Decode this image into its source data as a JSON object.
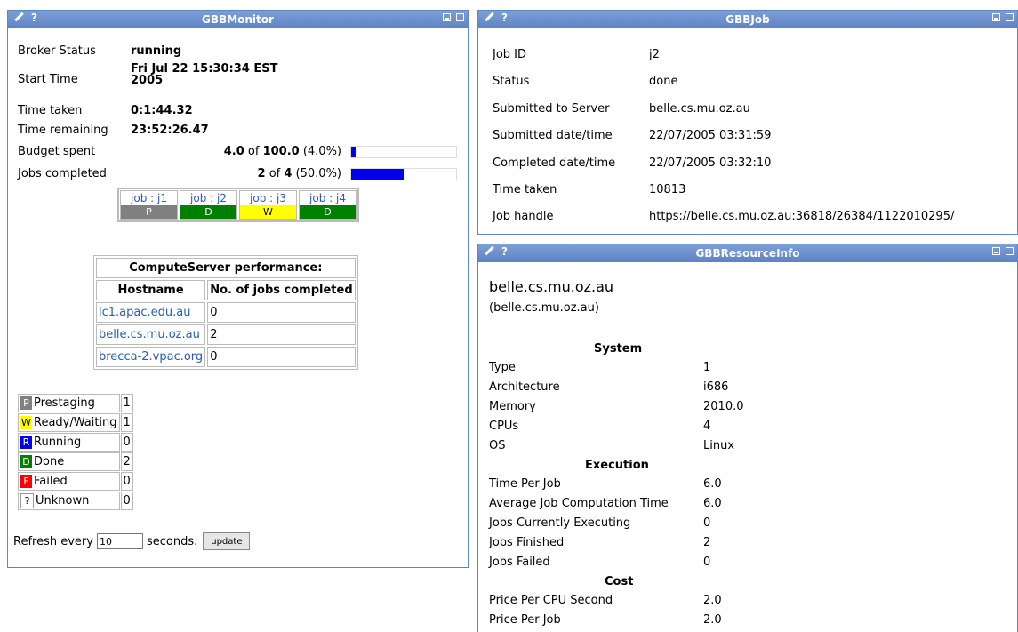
{
  "monitor": {
    "title": "GBBMonitor",
    "broker_status_label": "Broker Status",
    "broker_status": "running",
    "start_time_label": "Start Time",
    "start_time_line1": "Fri Jul 22 15:30:34 EST",
    "start_time_line2": "2005",
    "time_taken_label": "Time taken",
    "time_taken": "0:1:44.32",
    "time_remaining_label": "Time remaining",
    "time_remaining": "23:52:26.47",
    "budget_label": "Budget spent",
    "budget_spent": "4.0",
    "budget_of": "of",
    "budget_total": "100.0",
    "budget_pct": "(4.0%)",
    "budget_fraction": 0.04,
    "jobs_label": "Jobs completed",
    "jobs_done": "2",
    "jobs_of": "of",
    "jobs_total": "4",
    "jobs_pct": "(50.0%)",
    "jobs_fraction": 0.5,
    "jobs": [
      {
        "label": "job : j1",
        "status": "P",
        "color": "#808080",
        "text_color": "#ffffff"
      },
      {
        "label": "job : j2",
        "status": "D",
        "color": "#008000",
        "text_color": "#ffffff"
      },
      {
        "label": "job : j3",
        "status": "W",
        "color": "#ffff00",
        "text_color": "#000000"
      },
      {
        "label": "job : j4",
        "status": "D",
        "color": "#008000",
        "text_color": "#ffffff"
      }
    ],
    "perf": {
      "title": "ComputeServer performance:",
      "col_hostname": "Hostname",
      "col_jobs": "No. of jobs completed",
      "rows": [
        {
          "host": "lc1.apac.edu.au",
          "count": "0"
        },
        {
          "host": "belle.cs.mu.oz.au",
          "count": "2"
        },
        {
          "host": "brecca-2.vpac.org",
          "count": "0"
        }
      ]
    },
    "legend": [
      {
        "code": "P",
        "name": "Prestaging",
        "count": "1",
        "color": "#808080",
        "text_color": "#ffffff"
      },
      {
        "code": "W",
        "name": "Ready/Waiting",
        "count": "1",
        "color": "#ffff00",
        "text_color": "#000000"
      },
      {
        "code": "R",
        "name": "Running",
        "count": "0",
        "color": "#0000ee",
        "text_color": "#ffffff"
      },
      {
        "code": "D",
        "name": "Done",
        "count": "2",
        "color": "#008000",
        "text_color": "#ffffff"
      },
      {
        "code": "F",
        "name": "Failed",
        "count": "0",
        "color": "#ff0000",
        "text_color": "#ffffff"
      },
      {
        "code": "?",
        "name": "Unknown",
        "count": "0",
        "color": "#ffffff",
        "text_color": "#000000"
      }
    ],
    "refresh_label": "Refresh every",
    "refresh_value": "10",
    "refresh_unit": "seconds.",
    "update_label": "update"
  },
  "job": {
    "title": "GBBJob",
    "rows": [
      {
        "label": "Job ID",
        "value": "j2"
      },
      {
        "label": "Status",
        "value": "done"
      },
      {
        "label": "Submitted to Server",
        "value": "belle.cs.mu.oz.au"
      },
      {
        "label": "Submitted date/time",
        "value": "22/07/2005 03:31:59"
      },
      {
        "label": "Completed date/time",
        "value": "22/07/2005 03:32:10"
      },
      {
        "label": "Time taken",
        "value": "10813"
      },
      {
        "label": "Job handle",
        "value": "https://belle.cs.mu.oz.au:36818/26384/1122010295/"
      }
    ]
  },
  "resource": {
    "title": "GBBResourceInfo",
    "host": "belle.cs.mu.oz.au",
    "host_sub": "(belle.cs.mu.oz.au)",
    "system_heading": "System",
    "system": [
      {
        "label": "Type",
        "value": "1"
      },
      {
        "label": "Architecture",
        "value": "i686"
      },
      {
        "label": "Memory",
        "value": "2010.0"
      },
      {
        "label": "CPUs",
        "value": "4"
      },
      {
        "label": "OS",
        "value": "Linux"
      }
    ],
    "execution_heading": "Execution",
    "execution": [
      {
        "label": "Time Per Job",
        "value": "6.0"
      },
      {
        "label": "Average Job Computation Time",
        "value": "6.0"
      },
      {
        "label": "Jobs Currently Executing",
        "value": "0"
      },
      {
        "label": "Jobs Finished",
        "value": "2"
      },
      {
        "label": "Jobs Failed",
        "value": "0"
      }
    ],
    "cost_heading": "Cost",
    "cost": [
      {
        "label": "Price Per CPU Second",
        "value": "2.0"
      },
      {
        "label": "Price Per Job",
        "value": "2.0"
      }
    ]
  },
  "icons": {
    "edit": "pencil-icon",
    "help": "help-icon",
    "minimize": "minimize-icon",
    "maximize": "maximize-icon"
  },
  "colors": {
    "titlebar": "#6b8fcf",
    "link": "#2a5db0",
    "progress": "#0000ee"
  }
}
